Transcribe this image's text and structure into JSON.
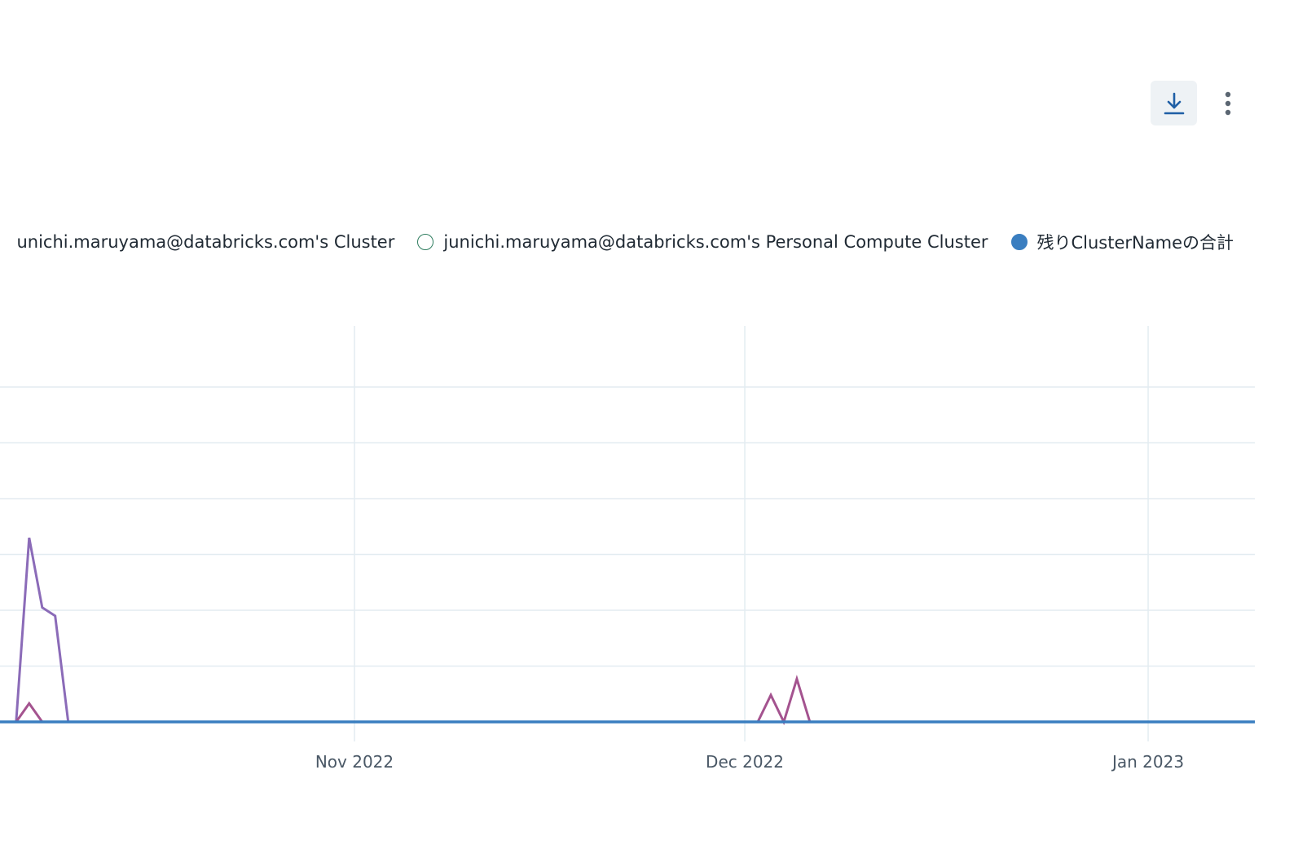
{
  "toolbar": {
    "download_icon": "download-icon",
    "more_icon": "vertical-ellipsis-icon"
  },
  "legend": {
    "items": [
      {
        "label": "unichi.maruyama@databricks.com's Cluster",
        "marker": "none"
      },
      {
        "label": "junichi.maruyama@databricks.com's Personal Compute Cluster",
        "marker": "hollow-circle",
        "color": "#2f7d5f"
      },
      {
        "label": "残りClusterNameの合計",
        "marker": "filled-circle",
        "color": "#3a7ec0"
      }
    ]
  },
  "chart_data": {
    "type": "line",
    "grid": true,
    "x_ticks": [
      "Nov 2022",
      "Dec 2022",
      "Jan 2023"
    ],
    "ylim": [
      0,
      6
    ],
    "series": [
      {
        "name": "unichi.maruyama@databricks.com's Cluster",
        "color": "#8b6bb8",
        "points": [
          [
            "2022-10-06",
            0
          ],
          [
            "2022-10-07",
            3.3
          ],
          [
            "2022-10-08",
            2.05
          ],
          [
            "2022-10-09",
            1.9
          ],
          [
            "2022-10-10",
            0
          ]
        ]
      },
      {
        "name": "junichi.maruyama@databricks.com's Personal Compute Cluster",
        "color": "#a4538f",
        "points": [
          [
            "2022-10-06",
            0
          ],
          [
            "2022-10-07",
            0.33
          ],
          [
            "2022-10-08",
            0
          ],
          [
            "2022-12-02",
            0
          ],
          [
            "2022-12-03",
            0.48
          ],
          [
            "2022-12-04",
            0
          ],
          [
            "2022-12-05",
            0.77
          ],
          [
            "2022-12-06",
            0
          ]
        ]
      },
      {
        "name": "残りClusterNameの合計",
        "color": "#3a7ec0",
        "points": [
          [
            "2022-10-05",
            0
          ],
          [
            "2023-01-07",
            0
          ]
        ]
      }
    ]
  }
}
